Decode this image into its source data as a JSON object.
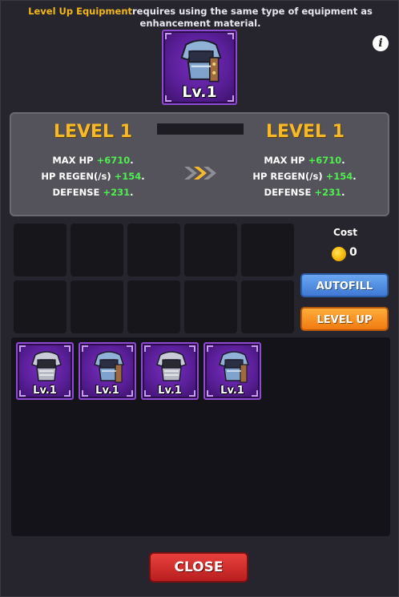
{
  "header": {
    "note_highlight": "Level Up Equipment",
    "note_rest": "requires using the same type of equipment as enhancement material."
  },
  "icons": {
    "info": "info-icon",
    "arrow": "double-chevron-right-icon",
    "coin": "gold-coin-icon",
    "equipment": "shoulder-armor-icon"
  },
  "selected_item": {
    "level_label": "Lv.1"
  },
  "current": {
    "title": "LEVEL 1",
    "stats": [
      {
        "label": "MAX HP",
        "value": "+6710"
      },
      {
        "label": "HP REGEN(/s)",
        "value": "+154"
      },
      {
        "label": "DEFENSE",
        "value": "+231"
      }
    ]
  },
  "next": {
    "title": "LEVEL 1",
    "stats": [
      {
        "label": "MAX HP",
        "value": "+6710"
      },
      {
        "label": "HP REGEN(/s)",
        "value": "+154"
      },
      {
        "label": "DEFENSE",
        "value": "+231"
      }
    ]
  },
  "cost": {
    "label": "Cost",
    "value": "0"
  },
  "buttons": {
    "autofill": "AUTOFILL",
    "level_up": "LEVEL UP",
    "close": "CLOSE"
  },
  "inventory": [
    {
      "level_label": "Lv.1",
      "variant": "silver"
    },
    {
      "level_label": "Lv.1",
      "variant": "blue"
    },
    {
      "level_label": "Lv.1",
      "variant": "silver"
    },
    {
      "level_label": "Lv.1",
      "variant": "blue"
    }
  ],
  "colors": {
    "accent_gold": "#f6b92a",
    "stat_green": "#4ef04e",
    "rarity_purple": "#5a1f99"
  }
}
